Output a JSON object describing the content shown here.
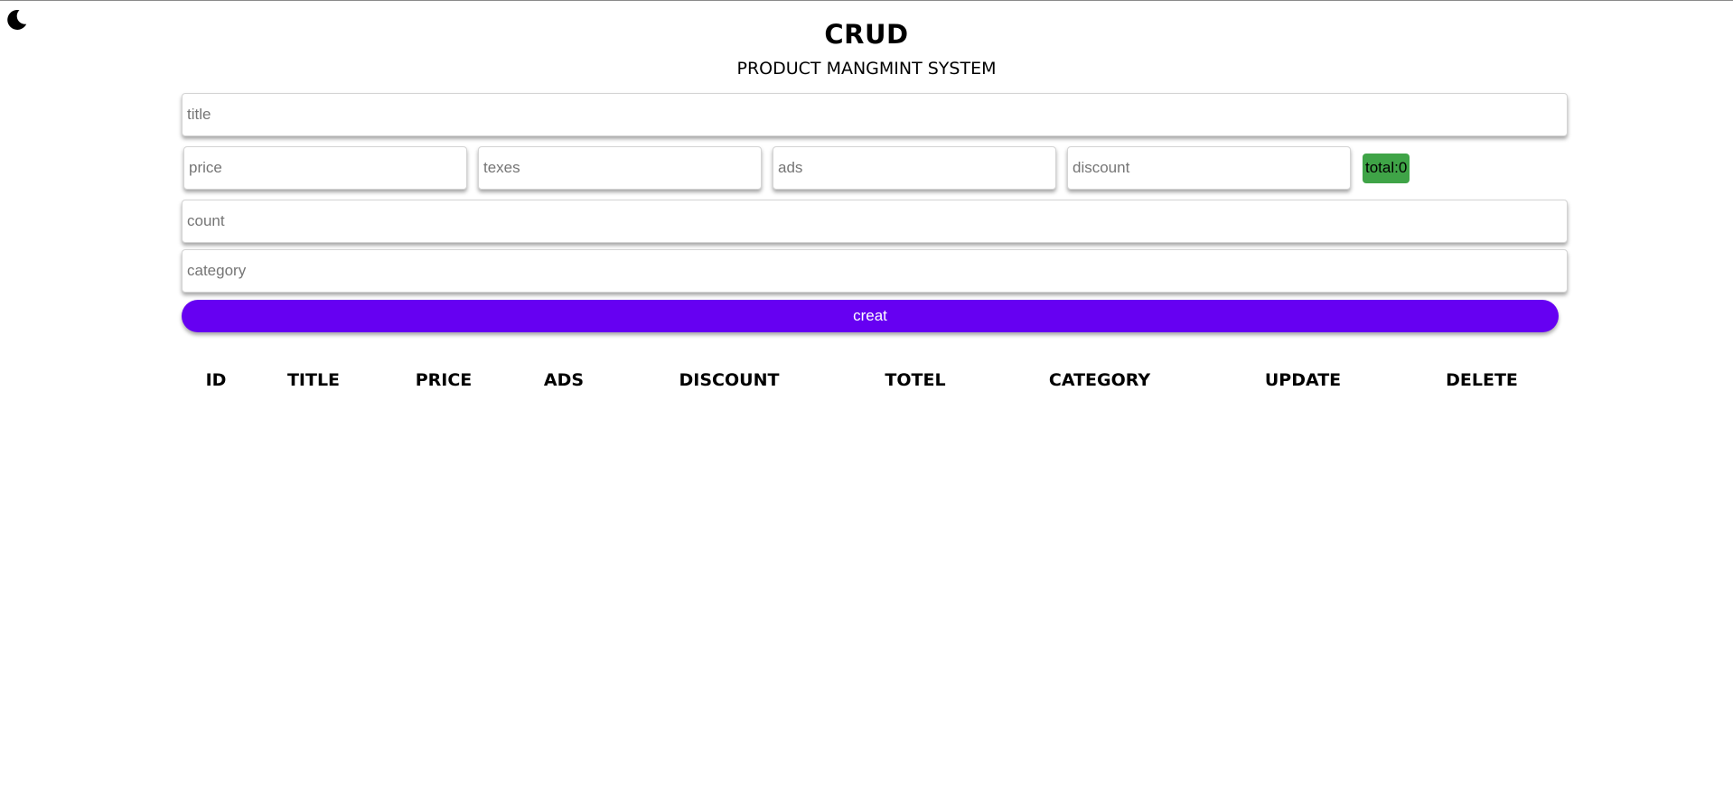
{
  "theme_toggle": {
    "icon": "moon-icon"
  },
  "header": {
    "title": "CRUD",
    "subtitle": "PRODUCT MANGMINT SYSTEM"
  },
  "form": {
    "title": {
      "placeholder": "title",
      "value": ""
    },
    "price": {
      "placeholder": "price",
      "value": ""
    },
    "taxes": {
      "placeholder": "texes",
      "value": ""
    },
    "ads": {
      "placeholder": "ads",
      "value": ""
    },
    "discount": {
      "placeholder": "discount",
      "value": ""
    },
    "total_label": "total:0",
    "count": {
      "placeholder": "count",
      "value": ""
    },
    "category": {
      "placeholder": "category",
      "value": ""
    },
    "create_label": "creat"
  },
  "colors": {
    "total_badge": "#3fa447",
    "create_button": "#6600f2"
  },
  "table": {
    "headers": [
      "ID",
      "TITLE",
      "PRICE",
      "ADS",
      "DISCOUNT",
      "TOTEL",
      "CATEGORY",
      "UPDATE",
      "DELETE"
    ],
    "rows": []
  }
}
